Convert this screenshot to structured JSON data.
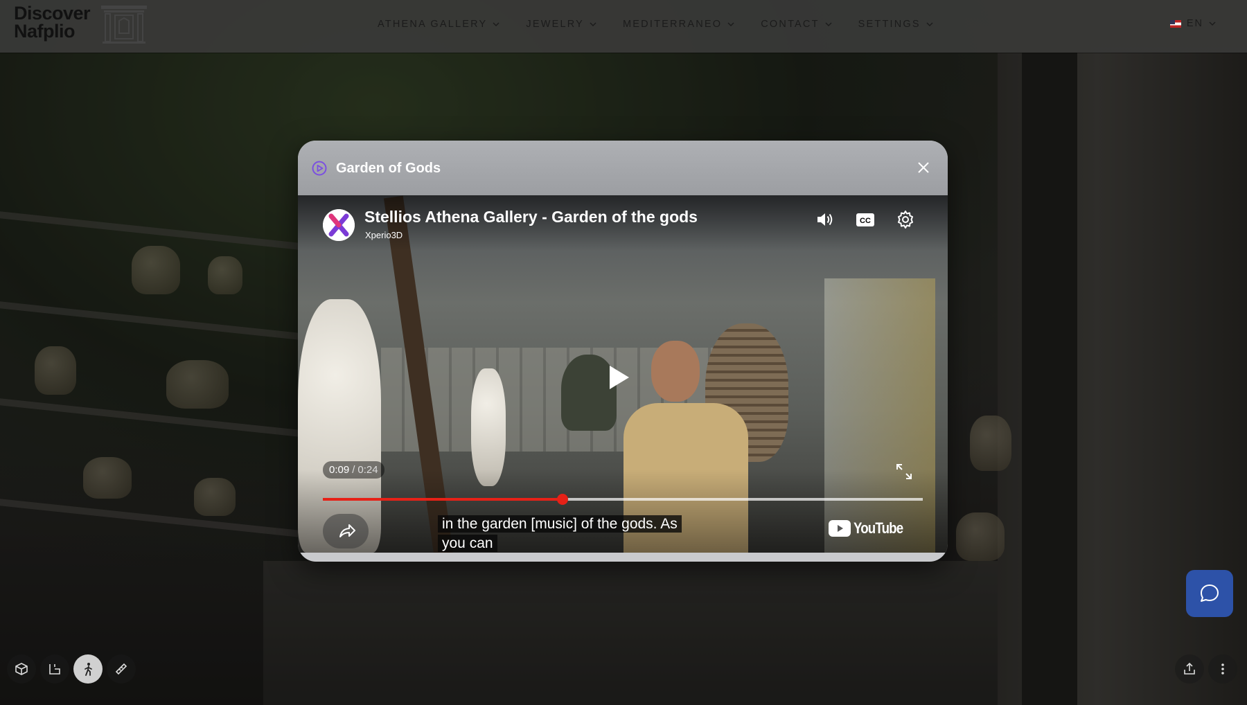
{
  "brand": {
    "line1": "Discover",
    "line2": "Nafplio"
  },
  "nav": {
    "items": [
      {
        "label": "ATHENA GALLERY"
      },
      {
        "label": "JEWELRY"
      },
      {
        "label": "MEDITERRANEO"
      },
      {
        "label": "CONTACT"
      },
      {
        "label": "SETTINGS"
      }
    ],
    "language": "EN"
  },
  "modal": {
    "title": "Garden of Gods",
    "icon": "play-circle-icon",
    "accent_color": "#7b4fe0"
  },
  "video": {
    "title": "Stellios Athena Gallery - Garden of the gods",
    "channel": "Xperio3D",
    "current_time": "0:09",
    "duration": "0:24",
    "progress": 0.4,
    "caption_line1": "in the garden [music] of the gods. As",
    "caption_line2": "you can",
    "brand": "YouTube",
    "progress_color": "#e62117",
    "controls": [
      "volume-icon",
      "closed-captions-icon",
      "settings-gear-icon"
    ]
  },
  "toolbar": {
    "left": [
      "dollhouse-view-icon",
      "floor-plan-icon",
      "walk-mode-icon",
      "measure-tape-icon"
    ],
    "right": [
      "share-upload-icon",
      "more-vertical-icon"
    ]
  },
  "chat": {
    "icon": "chat-bubble-icon",
    "color": "#2d52a8"
  }
}
